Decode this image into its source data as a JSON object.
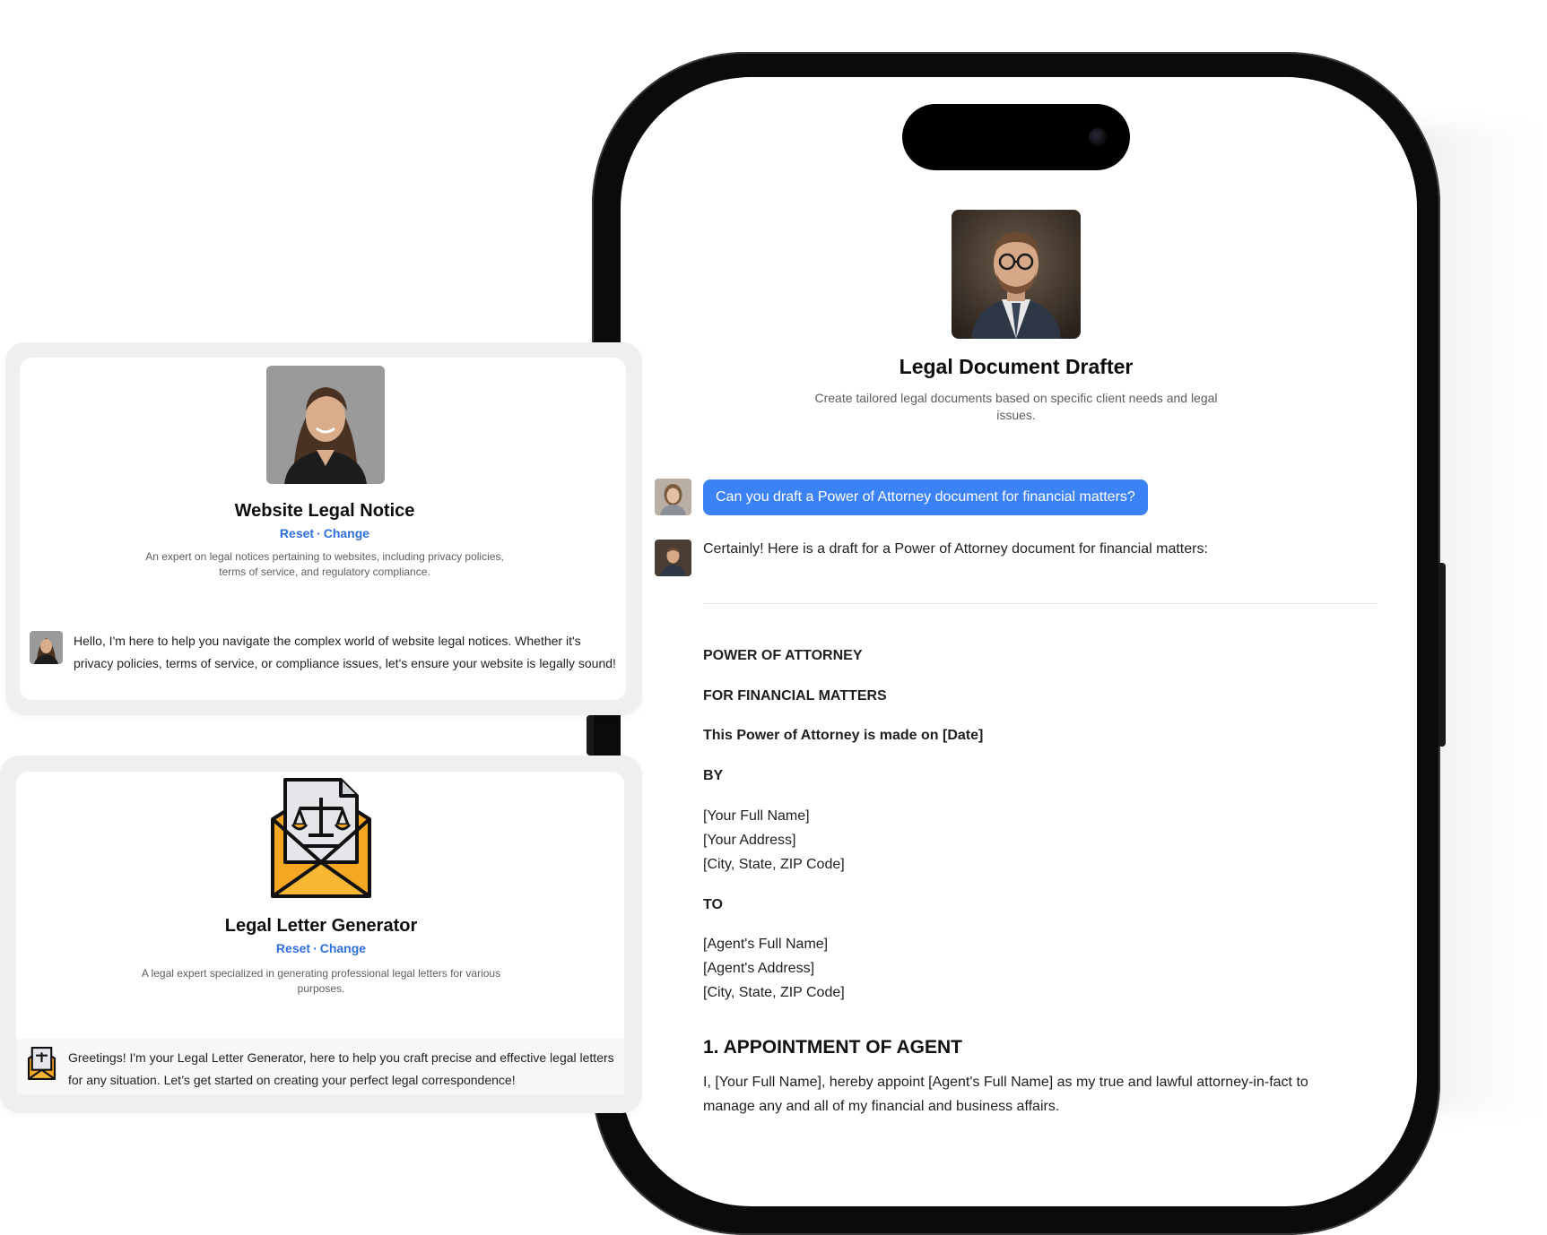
{
  "gpt": {
    "title": "Legal Document Drafter",
    "description": "Create tailored legal documents based on specific client needs and legal issues."
  },
  "chat": {
    "user_message": "Can you draft a Power of Attorney document for financial matters?",
    "assistant_intro": "Certainly! Here is a draft for a Power of Attorney document for financial matters:"
  },
  "document": {
    "title": "POWER OF ATTORNEY",
    "subtitle": "FOR FINANCIAL MATTERS",
    "made_on": "This Power of Attorney is made on [Date]",
    "by_label": "BY",
    "principal": [
      "[Your Full Name]",
      "[Your Address]",
      "[City, State, ZIP Code]"
    ],
    "to_label": "TO",
    "agent": [
      "[Agent's Full Name]",
      "[Agent's Address]",
      "[City, State, ZIP Code]"
    ],
    "section1_heading": "1. APPOINTMENT OF AGENT",
    "section1_text": "I, [Your Full Name], hereby appoint [Agent's Full Name] as my true and lawful attorney-in-fact to manage any and all of my financial and business affairs."
  },
  "cards": [
    {
      "title": "Website Legal Notice",
      "reset_label": "Reset",
      "separator": "·",
      "change_label": "Change",
      "description": "An expert on legal notices pertaining to websites, including privacy policies, terms of service, and regulatory compliance.",
      "greeting": "Hello, I'm here to help you navigate the complex world of website legal notices. Whether it's privacy policies, terms of service, or compliance issues, let's ensure your website is legally sound!"
    },
    {
      "title": "Legal Letter Generator",
      "reset_label": "Reset",
      "separator": "·",
      "change_label": "Change",
      "description": "A legal expert specialized in generating professional legal letters for various purposes.",
      "greeting": "Greetings! I'm your Legal Letter Generator, here to help you craft precise and effective legal letters for any situation. Let’s get started on creating your perfect legal correspondence!"
    }
  ],
  "icons": {
    "gpt_avatar": "lawyer-portrait-icon",
    "user_avatar": "user-portrait-icon",
    "card1_avatar": "woman-portrait-icon",
    "card2_avatar": "legal-letter-envelope-icon"
  },
  "colors": {
    "accent": "#3b82f6",
    "link": "#2f6fde",
    "envelope": "#f5a623"
  }
}
